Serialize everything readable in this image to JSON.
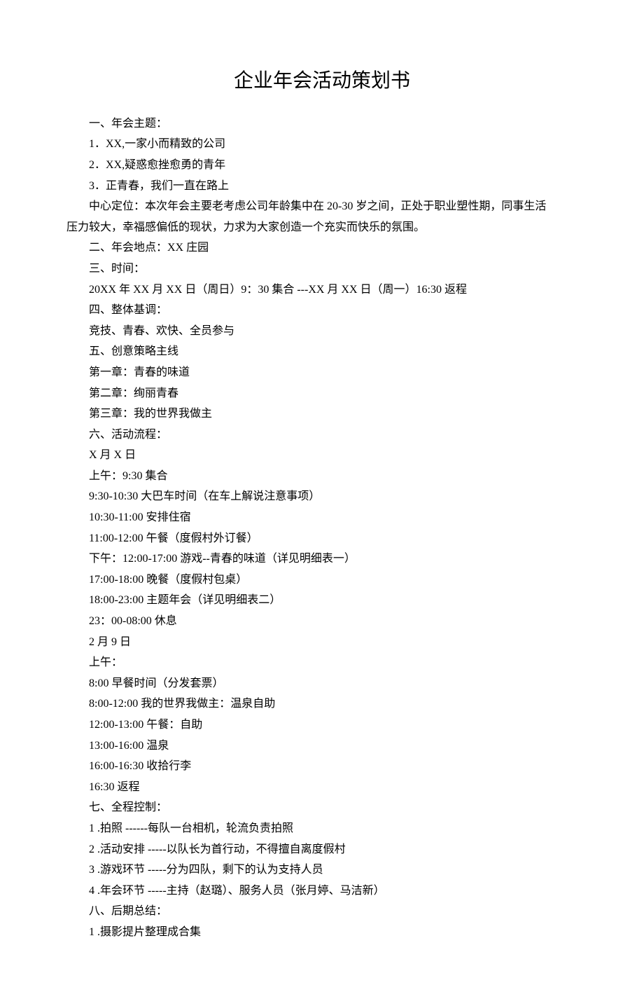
{
  "title": "企业年会活动策划书",
  "lines": [
    "一、年会主题：",
    "1．XX,一家小而精致的公司",
    "2．XX,疑惑愈挫愈勇的青年",
    "3．正青春，我们一直在路上",
    "中心定位：本次年会主要老考虑公司年龄集中在 20-30 岁之间，正处于职业塑性期，同事生活",
    "压力较大，幸福感偏低的现状，力求为大家创造一个充实而快乐的氛围。",
    "二、年会地点：XX 庄园",
    "三、时间：",
    "20XX 年 XX 月 XX 日（周日）9：30 集合 ---XX 月 XX 日（周一）16:30 返程",
    "四、整体基调：",
    "竞技、青春、欢快、全员参与",
    "五、创意策略主线",
    "第一章：青春的味道",
    "第二章：绚丽青春",
    "第三章：我的世界我做主",
    "六、活动流程：",
    "X 月 X 日",
    "上午：9:30 集合",
    "9:30-10:30 大巴车时间（在车上解说注意事项）",
    "10:30-11:00 安排住宿",
    "11:00-12:00 午餐（度假村外订餐）",
    "下午：12:00-17:00 游戏--青春的味道（详见明细表一）",
    "17:00-18:00 晚餐（度假村包桌）",
    "18:00-23:00 主题年会（详见明细表二）",
    "23：00-08:00 休息",
    "2 月 9 日",
    "上午：",
    "8:00 早餐时间（分发套票）",
    "8:00-12:00 我的世界我做主：温泉自助",
    "12:00-13:00 午餐：自助",
    "13:00-16:00 温泉",
    "16:00-16:30 收拾行李",
    "16:30 返程",
    "七、全程控制：",
    "1 .拍照 ------每队一台相机，轮流负责拍照",
    "2 .活动安排 -----以队长为首行动，不得擅自离度假村",
    "3 .游戏环节 -----分为四队，剩下的认为支持人员",
    "4 .年会环节 -----主持（赵璐）、服务人员（张月婷、马洁新）",
    "八、后期总结：",
    "1 .摄影提片整理成合集"
  ],
  "indentFlags": [
    true,
    true,
    true,
    true,
    true,
    false,
    true,
    true,
    true,
    true,
    true,
    true,
    true,
    true,
    true,
    true,
    true,
    true,
    true,
    true,
    true,
    true,
    true,
    true,
    true,
    true,
    true,
    true,
    true,
    true,
    true,
    true,
    true,
    true,
    true,
    true,
    true,
    true,
    true,
    true
  ]
}
